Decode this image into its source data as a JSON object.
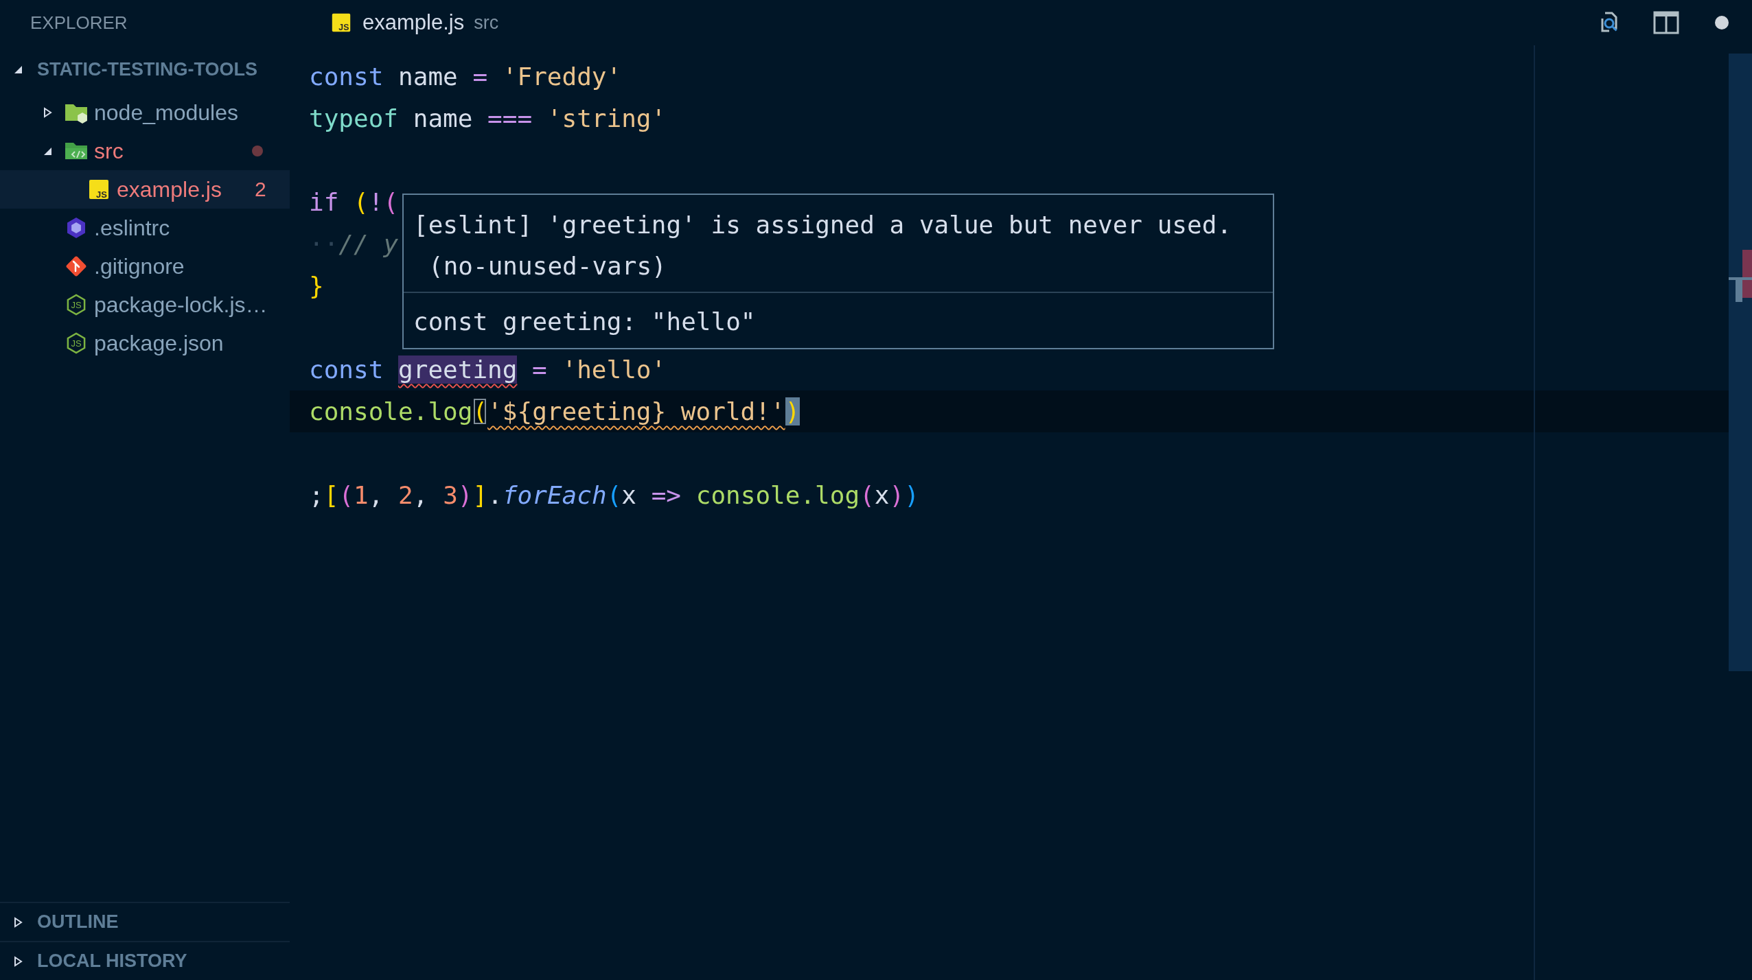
{
  "sidebar": {
    "title": "EXPLORER",
    "sections": [
      {
        "title": "STATIC-TESTING-TOOLS",
        "expanded": true,
        "items": [
          {
            "label": "node_modules",
            "kind": "node-folder",
            "expanded": false,
            "selected": false,
            "problems": false
          },
          {
            "label": "src",
            "kind": "src-folder",
            "expanded": true,
            "selected": false,
            "problems": true,
            "children": [
              {
                "label": "example.js",
                "kind": "js-file",
                "icon_label": "JS",
                "selected": true,
                "problems": true,
                "problem_count": "2"
              }
            ]
          },
          {
            "label": ".eslintrc",
            "kind": "eslint-file",
            "selected": false,
            "problems": false
          },
          {
            "label": ".gitignore",
            "kind": "git-file",
            "selected": false,
            "problems": false
          },
          {
            "label": "package-lock.js…",
            "kind": "node-file",
            "icon_label": "JS",
            "selected": false,
            "problems": false
          },
          {
            "label": "package.json",
            "kind": "node-file",
            "icon_label": "JS",
            "selected": false,
            "problems": false
          }
        ]
      },
      {
        "title": "OUTLINE",
        "expanded": false
      },
      {
        "title": "LOCAL HISTORY",
        "expanded": false
      }
    ]
  },
  "tabs": [
    {
      "label": "example.js",
      "description": "src",
      "kind": "js-file",
      "icon_label": "JS",
      "selected": true
    }
  ],
  "editor": {
    "lines": [
      {
        "kind": "code",
        "current": false,
        "tokens": [
          {
            "text": "const",
            "kind": "decl"
          },
          {
            "text": " name ",
            "kind": "ident"
          },
          {
            "text": "= ",
            "kind": "operator"
          },
          {
            "text": "'Freddy'",
            "kind": "string"
          }
        ]
      },
      {
        "kind": "code",
        "current": false,
        "tokens": [
          {
            "text": "typeof",
            "kind": "typeop"
          },
          {
            "text": " name ",
            "kind": "ident"
          },
          {
            "text": "=== ",
            "kind": "operator"
          },
          {
            "text": "'string'",
            "kind": "string"
          }
        ]
      },
      {
        "kind": "blank",
        "current": false
      },
      {
        "kind": "code",
        "current": false,
        "tokens": [
          {
            "text": "if ",
            "kind": "control"
          },
          {
            "text": "(",
            "kind": "bracket-1"
          },
          {
            "text": "!",
            "kind": "operator"
          },
          {
            "text": "(",
            "kind": "bracket-2"
          }
        ]
      },
      {
        "kind": "code",
        "current": false,
        "tokens": [
          {
            "text": "··",
            "kind": "whitespace"
          },
          {
            "text": "// y",
            "kind": "comment"
          }
        ]
      },
      {
        "kind": "code",
        "current": false,
        "tokens": [
          {
            "text": "}",
            "kind": "bracket-1"
          }
        ]
      },
      {
        "kind": "blank",
        "current": false
      },
      {
        "kind": "code",
        "current": false,
        "tokens": [
          {
            "text": "const ",
            "kind": "decl"
          },
          {
            "text": "greeting",
            "kind": "ident",
            "highlighted": true,
            "error": true
          },
          {
            "text": " = ",
            "kind": "operator"
          },
          {
            "text": "'hello'",
            "kind": "string"
          }
        ]
      },
      {
        "kind": "code",
        "current": true,
        "tokens": [
          {
            "text": "console.log",
            "kind": "function"
          },
          {
            "text": "(",
            "kind": "bracket-1",
            "bracket_match": true
          },
          {
            "text": "'${greeting} world!'",
            "kind": "string",
            "warning": true
          },
          {
            "text": ")",
            "kind": "bracket-1",
            "selected": true
          }
        ]
      },
      {
        "kind": "blank",
        "current": false
      },
      {
        "kind": "code",
        "current": false,
        "tokens": [
          {
            "text": ";",
            "kind": "punct"
          },
          {
            "text": "[",
            "kind": "bracket-1"
          },
          {
            "text": "(",
            "kind": "bracket-2"
          },
          {
            "text": "1",
            "kind": "number"
          },
          {
            "text": ", ",
            "kind": "punct"
          },
          {
            "text": "2",
            "kind": "number"
          },
          {
            "text": ", ",
            "kind": "punct"
          },
          {
            "text": "3",
            "kind": "number"
          },
          {
            "text": ")",
            "kind": "bracket-2"
          },
          {
            "text": "]",
            "kind": "bracket-1"
          },
          {
            "text": ".",
            "kind": "punct"
          },
          {
            "text": "forEach",
            "kind": "method"
          },
          {
            "text": "(",
            "kind": "bracket-3"
          },
          {
            "text": "x ",
            "kind": "ident"
          },
          {
            "text": "=> ",
            "kind": "operator"
          },
          {
            "text": "console.log",
            "kind": "function"
          },
          {
            "text": "(",
            "kind": "bracket-2"
          },
          {
            "text": "x",
            "kind": "ident"
          },
          {
            "text": ")",
            "kind": "bracket-2"
          },
          {
            "text": ")",
            "kind": "bracket-3"
          }
        ]
      }
    ],
    "hover": {
      "message": "[eslint] 'greeting' is assigned a value but never used.",
      "rule": "(no-unused-vars)",
      "signature": "const greeting: \"hello\""
    }
  }
}
